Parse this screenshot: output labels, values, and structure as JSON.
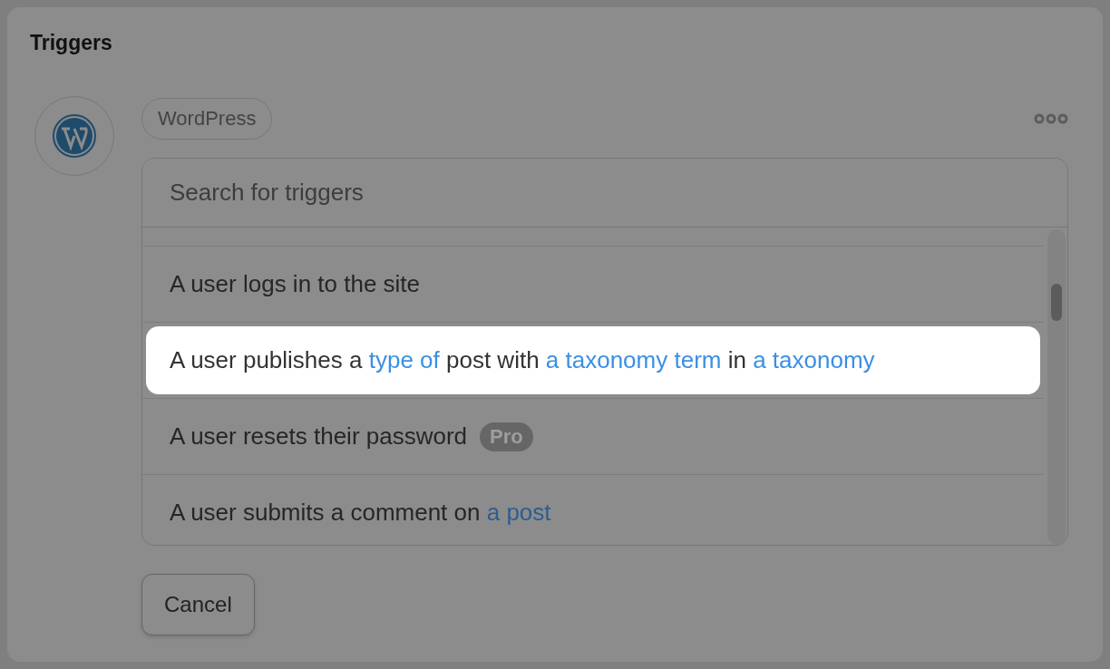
{
  "panel": {
    "title": "Triggers"
  },
  "integration": {
    "name": "WordPress"
  },
  "search": {
    "placeholder": "Search for triggers"
  },
  "triggers": [
    {
      "highlighted": false,
      "segments": [
        {
          "text": "A user logs in to the site",
          "link": false
        }
      ]
    },
    {
      "highlighted": true,
      "segments": [
        {
          "text": "A user publishes a ",
          "link": false
        },
        {
          "text": "type of",
          "link": true
        },
        {
          "text": " post with ",
          "link": false
        },
        {
          "text": "a taxonomy term",
          "link": true
        },
        {
          "text": " in ",
          "link": false
        },
        {
          "text": "a taxonomy",
          "link": true
        }
      ]
    },
    {
      "highlighted": false,
      "badge": "Pro",
      "segments": [
        {
          "text": "A user resets their password",
          "link": false
        }
      ]
    },
    {
      "highlighted": false,
      "segments": [
        {
          "text": "A user submits a comment on ",
          "link": false
        },
        {
          "text": "a post",
          "link": true
        }
      ]
    }
  ],
  "buttons": [
    {
      "label": "Cancel"
    }
  ]
}
